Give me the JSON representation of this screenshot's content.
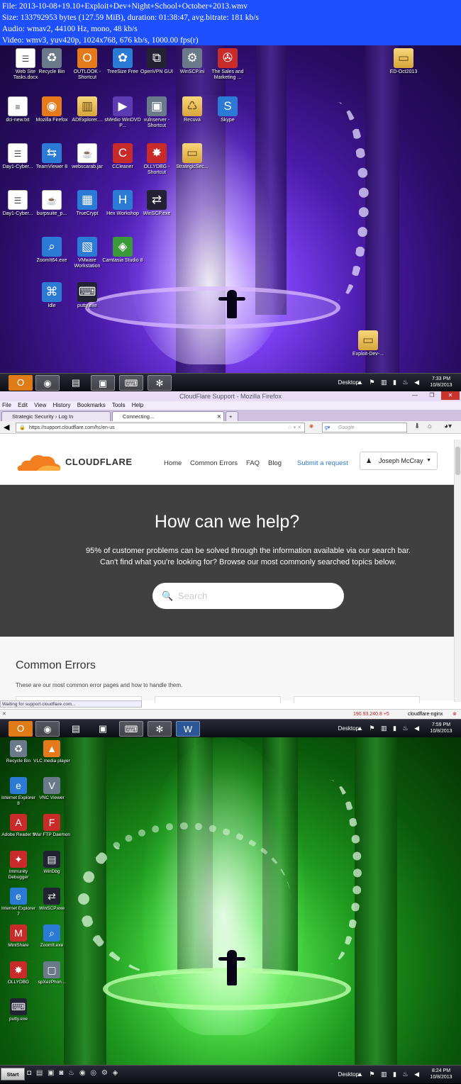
{
  "meta": {
    "line1": "File: 2013-10-08+19.10+Exploit+Dev+Night+School+October+2013.wmv",
    "line2": "Size: 133792953 bytes (127.59 MiB), duration: 01:38:47, avg.bitrate: 181 kb/s",
    "line3": "Audio: wmav2, 44100 Hz, mono, 48 kb/s",
    "line4": "Video: wmv3, yuv420p, 1024x768, 676 kb/s, 1000.00 fps(r)"
  },
  "desktop1": {
    "icons": [
      {
        "label": "Web Site Tasks.docx",
        "icon": "document-icon"
      },
      {
        "label": "Recycle Bin",
        "icon": "recycle-bin-icon"
      },
      {
        "label": "OUTLOOK - Shortcut",
        "icon": "outlook-icon"
      },
      {
        "label": "TreeSize Free",
        "icon": "treesize-icon"
      },
      {
        "label": "OpenVPN GUI",
        "icon": "openvpn-icon"
      },
      {
        "label": "WinSCP.ini",
        "icon": "settings-file-icon"
      },
      {
        "label": "The Sales and Marketing ...",
        "icon": "sales-icon"
      },
      {
        "label": "dci-new.txt",
        "icon": "text-file-icon"
      },
      {
        "label": "Mozilla Firefox",
        "icon": "firefox-icon"
      },
      {
        "label": "ADExplorer....",
        "icon": "adexplorer-icon"
      },
      {
        "label": "sMedio WinDVD P...",
        "icon": "windvd-icon"
      },
      {
        "label": "vulnserver - Shortcut",
        "icon": "vulnserver-icon"
      },
      {
        "label": "Recuva",
        "icon": "recuva-icon"
      },
      {
        "label": "Skype",
        "icon": "skype-icon"
      },
      {
        "label": "Day1-Cyber...",
        "icon": "document-icon"
      },
      {
        "label": "TeamViewer 8",
        "icon": "teamviewer-icon"
      },
      {
        "label": "webscarab.jar",
        "icon": "java-icon"
      },
      {
        "label": "CCleaner",
        "icon": "ccleaner-icon"
      },
      {
        "label": "OLLYDBG - Shortcut",
        "icon": "ollydbg-icon"
      },
      {
        "label": "StrategicSec...",
        "icon": "folder-icon"
      },
      {
        "label": "Day1-Cyber...",
        "icon": "document-icon"
      },
      {
        "label": "burpsuite_p...",
        "icon": "java-icon"
      },
      {
        "label": "TrueCrypt",
        "icon": "truecrypt-icon"
      },
      {
        "label": "Hex Workshop",
        "icon": "hex-workshop-icon"
      },
      {
        "label": "WinSCP.exe",
        "icon": "winscp-icon"
      },
      {
        "label": "ZoomIt64.exe",
        "icon": "zoomit-icon"
      },
      {
        "label": "VMware Workstation",
        "icon": "vmware-icon"
      },
      {
        "label": "Camtasia Studio 8",
        "icon": "camtasia-icon"
      },
      {
        "label": "Idle",
        "icon": "python-icon"
      },
      {
        "label": "putty.exe",
        "icon": "putty-icon"
      },
      {
        "label": "ED-Oct2013",
        "icon": "folder-icon"
      },
      {
        "label": "Exploit-Dev-...",
        "icon": "folder-icon"
      }
    ]
  },
  "taskbar1": {
    "desktop_label": "Desktop",
    "time": "7:33 PM",
    "date": "10/8/2013",
    "buttons": [
      "outlook-icon",
      "firefox-icon",
      "explorer-icon",
      "virtualbox-icon",
      "putty-icon",
      "app-icon"
    ]
  },
  "firefox": {
    "window_title": "CloudFlare Support - Mozilla Firefox",
    "menu": [
      "File",
      "Edit",
      "View",
      "History",
      "Bookmarks",
      "Tools",
      "Help"
    ],
    "tabs": [
      "Strategic Security › Log In",
      "Connecting..."
    ],
    "url": "https://support.cloudflare.com/hc/en-us",
    "search_placeholder": "Google",
    "status": "Waiting for support.cloudflare.com...",
    "addon_ip": "190.93.240.8",
    "addon_count": "+5",
    "addon_server": "cloudflare-nginx"
  },
  "cloudflare": {
    "logo_text": "CLOUDFLARE",
    "nav": [
      "Home",
      "Common Errors",
      "FAQ",
      "Blog"
    ],
    "submit_request": "Submit a request",
    "user_name": "Joseph McCray",
    "hero_title": "How can we help?",
    "hero_line1": "95% of customer problems can be solved through the information available via our search bar.",
    "hero_line2": "Can't find what you're looking for? Browse our most commonly searched topics below.",
    "search_placeholder": "Search",
    "section_title": "Common Errors",
    "section_desc": "These are our most common error pages and how to handle them.",
    "accent_color": "#f38020"
  },
  "taskbar2": {
    "desktop_label": "Desktop",
    "time": "7:59 PM",
    "date": "10/8/2013"
  },
  "desktop2": {
    "icons": [
      {
        "label": "Recycle Bin",
        "icon": "recycle-bin-icon"
      },
      {
        "label": "VLC media player",
        "icon": "vlc-icon"
      },
      {
        "label": "Internet Explorer 8",
        "icon": "internet-explorer-icon"
      },
      {
        "label": "VNC Viewer",
        "icon": "vnc-icon"
      },
      {
        "label": "Adobe Reader 9",
        "icon": "adobe-reader-icon"
      },
      {
        "label": "War FTP Daemon",
        "icon": "warftp-icon"
      },
      {
        "label": "Immunity Debugger",
        "icon": "immunity-icon"
      },
      {
        "label": "WinDbg",
        "icon": "windbg-icon"
      },
      {
        "label": "Internet Explorer 7",
        "icon": "internet-explorer-icon"
      },
      {
        "label": "WinSCP.exe",
        "icon": "winscp-icon"
      },
      {
        "label": "MiniShare",
        "icon": "minishare-icon"
      },
      {
        "label": "ZoomIt.exe",
        "icon": "zoomit-icon"
      },
      {
        "label": "OLLYDBG",
        "icon": "ollydbg-icon"
      },
      {
        "label": "spXezPhon...",
        "icon": "app-icon"
      },
      {
        "label": "putty.exe",
        "icon": "putty-icon"
      }
    ]
  },
  "taskbar3": {
    "start_label": "Start",
    "desktop_label": "Desktop",
    "time": "8:24 PM",
    "date": "10/8/2013"
  }
}
